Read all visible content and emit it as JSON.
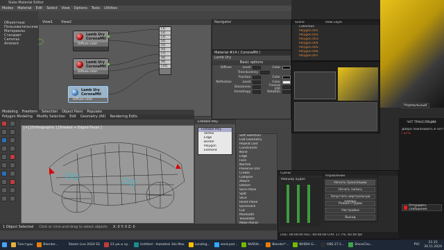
{
  "max": {
    "title": "Slate Material Editor",
    "menus": [
      "Modes",
      "Material",
      "Edit",
      "Select",
      "View",
      "Options",
      "Tools",
      "Utilities"
    ],
    "left_panel": [
      "Объектные",
      "Пользовательские",
      "Материалы",
      "Стандарт",
      "Cameras",
      "Ambient"
    ],
    "slate_tabs": [
      "View1",
      "View2"
    ],
    "nodes": [
      {
        "title": "Lamb Ury",
        "subtitle": "CoronaMtl",
        "label": "Diffuse color"
      },
      {
        "title": "Lamb Ury",
        "subtitle": "CoronaMtl",
        "label": "Diffuse color"
      },
      {
        "title": "Lamb Ury",
        "subtitle": "CoronaMtl",
        "label": "Diffuse color"
      }
    ],
    "material_slots": [
      "[1]",
      "[2]",
      "[3]",
      "[4]",
      "[5]",
      "[6]",
      "[7]",
      "[8]",
      "[9]",
      "[10]"
    ],
    "navigator_title": "Navigator",
    "params_title": "Material #14 ( CoronaMtl )",
    "params_subtitle": "Lamb Ury",
    "params_section": "Basic options",
    "params_rows": [
      {
        "label": "Diffuse",
        "value": "Level",
        "swatch": "Color"
      },
      {
        "label": "",
        "value": "Translucency",
        "swatch": ""
      },
      {
        "label": "",
        "value": "Fraction",
        "swatch": "Color"
      },
      {
        "label": "Reflection",
        "value": "Level",
        "swatch": "Color"
      },
      {
        "label": "",
        "value": "Glossiness",
        "swatch": "Fresnel IOR"
      },
      {
        "label": "",
        "value": "Anisotropy",
        "swatch": "Rotation"
      }
    ],
    "ribbon_tabs": [
      "Modeling",
      "Freeform",
      "Selection",
      "Object Paint",
      "Populate"
    ],
    "ribbon_sub": [
      "Polygon Modeling",
      "Modify Selection",
      "Edit",
      "Geometry (All)",
      "Rendering Edits"
    ],
    "viewport_label": "[+] [Orthographic ] [Shaded + Edged Faces ]",
    "modifier_title": "Editable Poly",
    "modifier_stack": [
      "Editable Poly",
      "Vertex",
      "Edge",
      "Border",
      "Polygon",
      "Element"
    ],
    "cmd_labels": [
      "Soft Selection",
      "Edit Geometry",
      "Repeat Last",
      "Constraints",
      "None",
      "Edge",
      "Face",
      "Normal",
      "Preserve UVs",
      "Create",
      "Collapse",
      "Attach",
      "Detach",
      "Slice Plane",
      "Split",
      "Slice",
      "Reset Plane",
      "QuickSlice",
      "Cut",
      "MSmooth",
      "Tessellate",
      "Make Planar",
      "X",
      "Y",
      "Z",
      "View Align",
      "Grid Align",
      "Relax",
      "Hide Selected",
      "Unhide All",
      "Hide Unselected"
    ],
    "status": "1 Object Selected",
    "status_hint": "Click or click-and-drag to select objects",
    "coords": "X: 0  Y: 0  Z: 0"
  },
  "blender": {
    "outliner_title": "Scene",
    "view_layer": "View Layer",
    "outliner_items": [
      "Collection",
      "Polygon.001",
      "Polygon.002",
      "Polygon.003",
      "Polygon.004",
      "Polygon.005",
      "Polygon.006",
      "Polygon.007"
    ]
  },
  "obs": {
    "controls_title": "Управление",
    "buttons": [
      "Начать трансляцию",
      "Начать запись",
      "Запустить виртуальную камеру",
      "Режим студии",
      "Настройки",
      "Выход"
    ],
    "scene_label": "Сцены",
    "sources_label": "Источники",
    "mixer_label": "Микшер аудио",
    "transitions": "Переходы между сценами",
    "bottom_tabs": [
      "Управление",
      "Переходы между сценами"
    ],
    "status": "LIVE: 00:00:00   REC: 00:00:00   CPU: 17.7%, 60.00 fps"
  },
  "chat": {
    "title": "ЧАТ ТРАНСЛЯЦИИ",
    "welcome": "Добро пожаловать в чат!",
    "user": "Гость",
    "send_button": "Отправить сообщение",
    "dropdown": "Нормальный"
  },
  "taskbar": {
    "items": [
      "Текстуры",
      "Blender...",
      "Steam Live 2024 SS",
      "23 уж и ну..",
      "Untitled - Autodesk 3ds Max",
      "Landing...",
      "seed.psd...",
      "NVIDIA...",
      "Blender*...",
      "NVIDIA G...",
      "OBS 27.2...",
      "ShareCha...",
      "20"
    ],
    "time": "21:15",
    "date": "30.11.2024",
    "lang": "РУС"
  },
  "colors": {
    "max_bg": "#444444",
    "node_socket": "#7be34b",
    "slot_bg": "#c9c9c9",
    "taskbar": "#1d2735",
    "chat_bg": "#1a1a1a",
    "car_yellow": "#e8c21a",
    "red_accent": "#c23b3b"
  }
}
